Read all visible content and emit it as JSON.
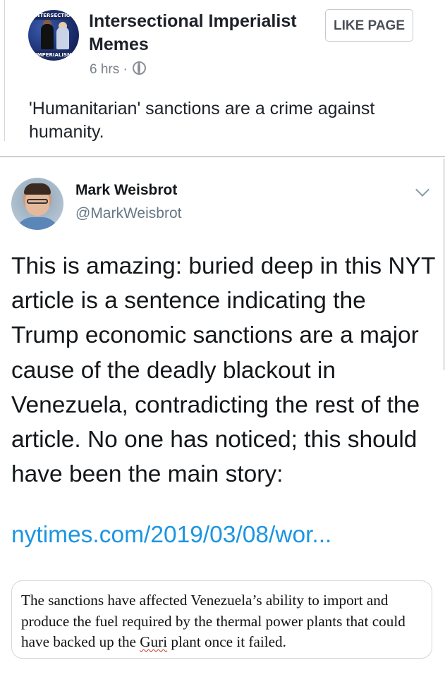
{
  "facebook_post": {
    "avatar_banner_top": "INTERSECTIONAL",
    "avatar_banner_bottom": "IMPERIALISM",
    "page_name": "Intersectional Imperialist Memes",
    "like_button_label": "LIKE PAGE",
    "timestamp": "6 hrs",
    "separator": "·",
    "privacy_icon": "globe-icon",
    "caption": "'Humanitarian' sanctions are a crime against humanity."
  },
  "tweet": {
    "author_name": "Mark Weisbrot",
    "author_handle": "@MarkWeisbrot",
    "menu_icon": "chevron-down-icon",
    "text": "This is amazing: buried deep in this NYT article is a sentence indicating the Trump economic sanctions are a major cause of the deadly blackout in Venezuela, contradicting the rest of the article. No one has noticed; this should have been the main story:",
    "link_text": "nytimes.com/2019/03/08/wor...",
    "quoted_image_text_part1": "The sanctions have affected Venezuela’s ability to import and produce the fuel required by the thermal power plants that could have backed up the ",
    "quoted_image_text_underlined": "Guri",
    "quoted_image_text_part2": " plant once it failed."
  },
  "colors": {
    "link": "#1b95e0",
    "handle": "#657786",
    "text": "#14171a"
  }
}
